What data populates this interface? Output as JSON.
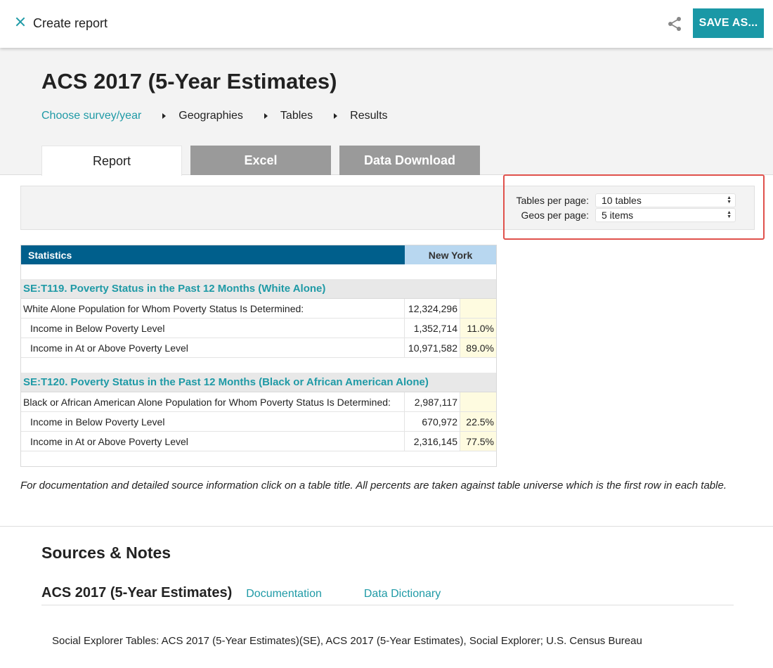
{
  "topbar": {
    "title": "Create report",
    "save_label": "SAVE AS..."
  },
  "header": {
    "title": "ACS 2017 (5-Year Estimates)",
    "breadcrumb": [
      "Choose survey/year",
      "Geographies",
      "Tables",
      "Results"
    ],
    "tabs": [
      "Report",
      "Excel",
      "Data Download"
    ]
  },
  "settings": {
    "tables_label": "Tables per page:",
    "tables_value": "10 tables",
    "geos_label": "Geos per page:",
    "geos_value": "5 items"
  },
  "table": {
    "header_stat": "Statistics",
    "header_geo": "New York",
    "sections": [
      {
        "title": "SE:T119. Poverty Status in the Past 12 Months (White Alone)",
        "rows": [
          {
            "label": "White Alone Population for Whom Poverty Status Is Determined:",
            "value": "12,324,296",
            "pct": ""
          },
          {
            "label": "Income in Below Poverty Level",
            "value": "1,352,714",
            "pct": "11.0%"
          },
          {
            "label": "Income in At or Above Poverty Level",
            "value": "10,971,582",
            "pct": "89.0%"
          }
        ]
      },
      {
        "title": "SE:T120. Poverty Status in the Past 12 Months (Black or African American Alone)",
        "rows": [
          {
            "label": "Black or African American Alone Population for Whom Poverty Status Is Determined:",
            "value": "2,987,117",
            "pct": ""
          },
          {
            "label": "Income in Below Poverty Level",
            "value": "670,972",
            "pct": "22.5%"
          },
          {
            "label": "Income in At or Above Poverty Level",
            "value": "2,316,145",
            "pct": "77.5%"
          }
        ]
      }
    ]
  },
  "footnote": "For documentation and detailed source information click on a table title.  All percents are taken against table universe which is the first row in each table.",
  "sources": {
    "title": "Sources & Notes",
    "name": "ACS 2017 (5-Year Estimates)",
    "doc_link": "Documentation",
    "dict_link": "Data Dictionary",
    "citation": "Social Explorer Tables: ACS 2017 (5-Year Estimates)(SE), ACS 2017 (5-Year Estimates), Social Explorer; U.S. Census Bureau"
  },
  "colors": {
    "accent": "#1a98a6",
    "table_header": "#005f8c",
    "geo_header": "#b8d7f0",
    "highlight": "#e0514c"
  }
}
